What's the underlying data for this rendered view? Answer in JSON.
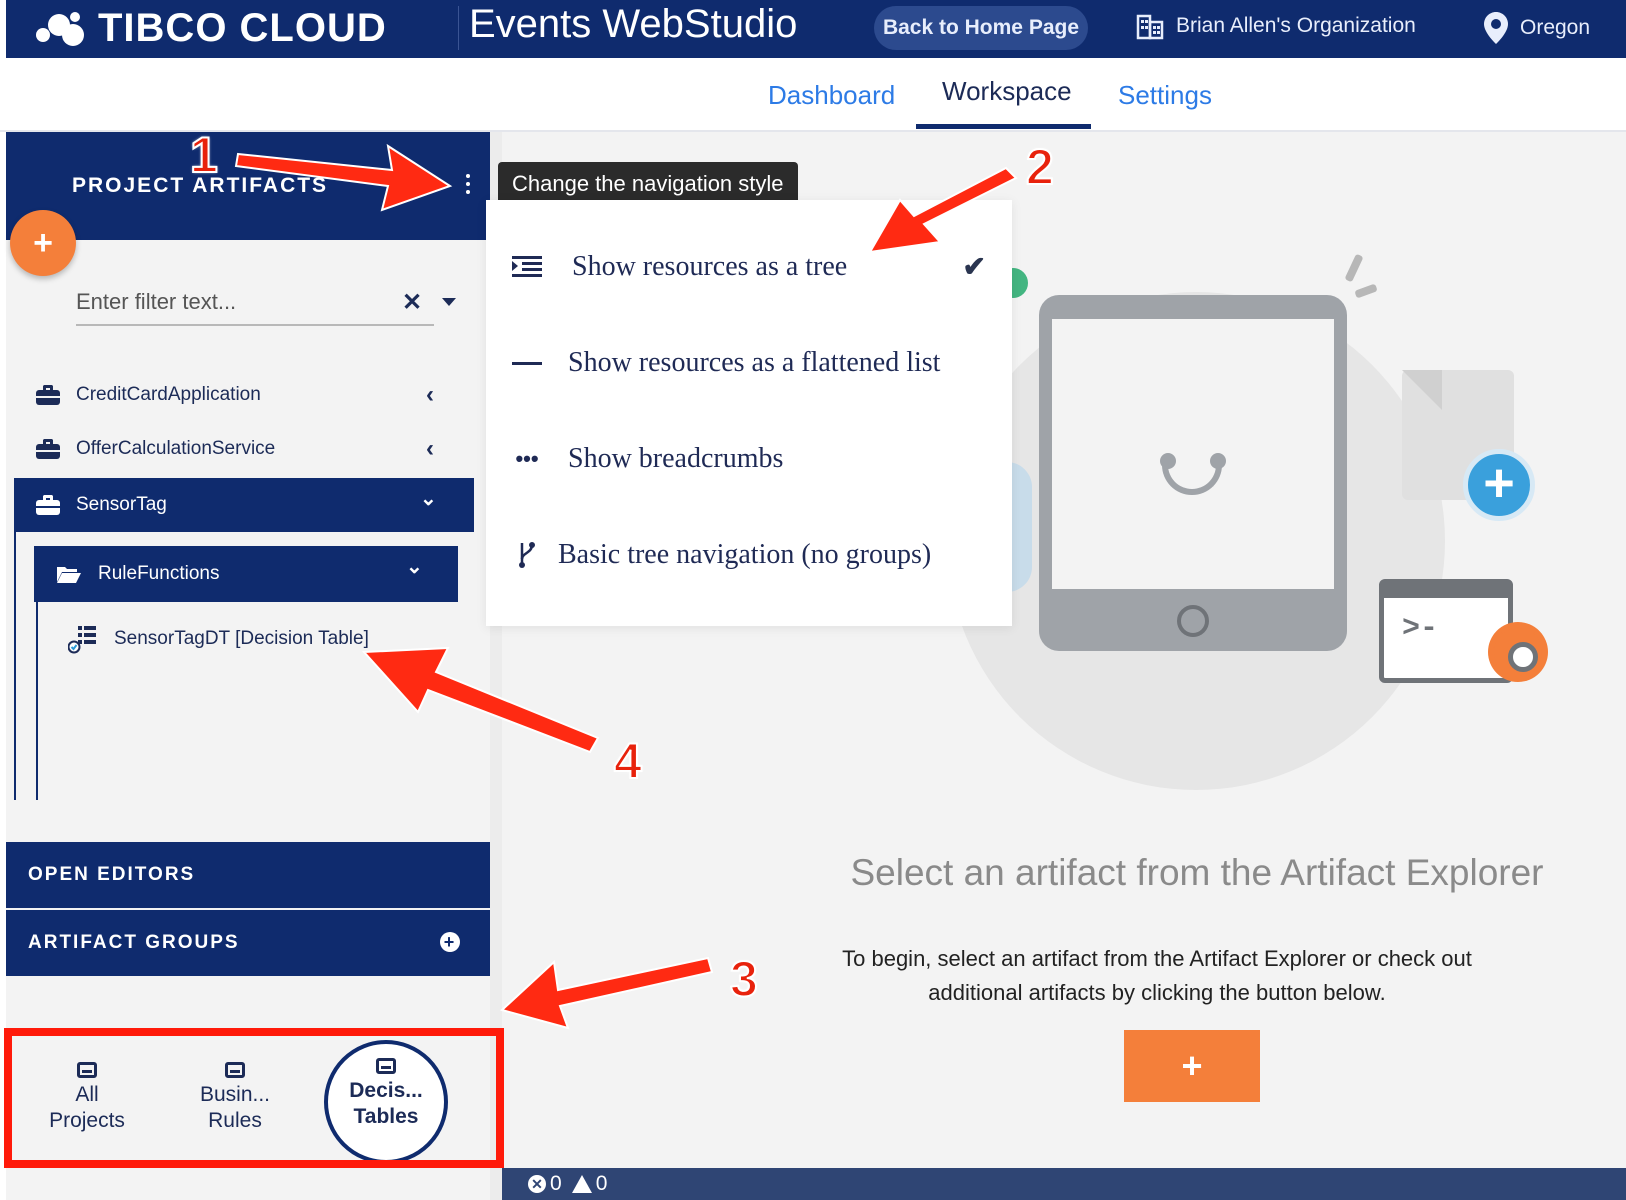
{
  "header": {
    "logo_text": "TIBCO CLOUD",
    "app_title": "Events WebStudio",
    "home_button": "Back to Home Page",
    "organization": "Brian Allen's Organization",
    "region": "Oregon"
  },
  "tabs": [
    {
      "label": "Dashboard",
      "active": false
    },
    {
      "label": "Workspace",
      "active": true
    },
    {
      "label": "Settings",
      "active": false
    }
  ],
  "sidebar": {
    "title": "PROJECT ARTIFACTS",
    "filter_placeholder": "Enter filter text...",
    "tree": [
      {
        "label": "CreditCardApplication",
        "icon": "briefcase-icon",
        "expanded": false
      },
      {
        "label": "OfferCalculationService",
        "icon": "briefcase-icon",
        "expanded": false
      },
      {
        "label": "SensorTag",
        "icon": "briefcase-icon",
        "expanded": true,
        "selected": true
      },
      {
        "label": "RuleFunctions",
        "icon": "folder-open-icon",
        "expanded": true,
        "selected": true
      },
      {
        "label": "SensorTagDT [Decision Table]",
        "icon": "decision-table-icon"
      }
    ],
    "open_editors": "OPEN EDITORS",
    "artifact_groups": "ARTIFACT GROUPS",
    "groups": [
      {
        "line1": "All",
        "line2": "Projects",
        "active": false
      },
      {
        "line1": "Busin...",
        "line2": "Rules",
        "active": false
      },
      {
        "line1": "Decis...",
        "line2": "Tables",
        "active": true
      }
    ]
  },
  "nav_menu": {
    "tooltip": "Change the navigation style",
    "items": [
      {
        "label": "Show resources as a tree",
        "checked": true
      },
      {
        "label": "Show resources as a flattened list",
        "checked": false
      },
      {
        "label": "Show breadcrumbs",
        "checked": false
      },
      {
        "label": "Basic tree navigation (no groups)",
        "checked": false
      }
    ]
  },
  "main": {
    "empty_title": "Select an artifact from the Artifact Explorer",
    "empty_body": "To begin, select an artifact from the Artifact Explorer or check out additional artifacts by clicking the button below.",
    "add_button": "+"
  },
  "status": {
    "errors": "0",
    "warnings": "0"
  },
  "annotations": [
    "1",
    "2",
    "3",
    "4"
  ],
  "colors": {
    "navy": "#0f2b6e",
    "orange": "#f47f3a",
    "link_blue": "#2d7be6",
    "annotation_red": "#e8220c"
  }
}
